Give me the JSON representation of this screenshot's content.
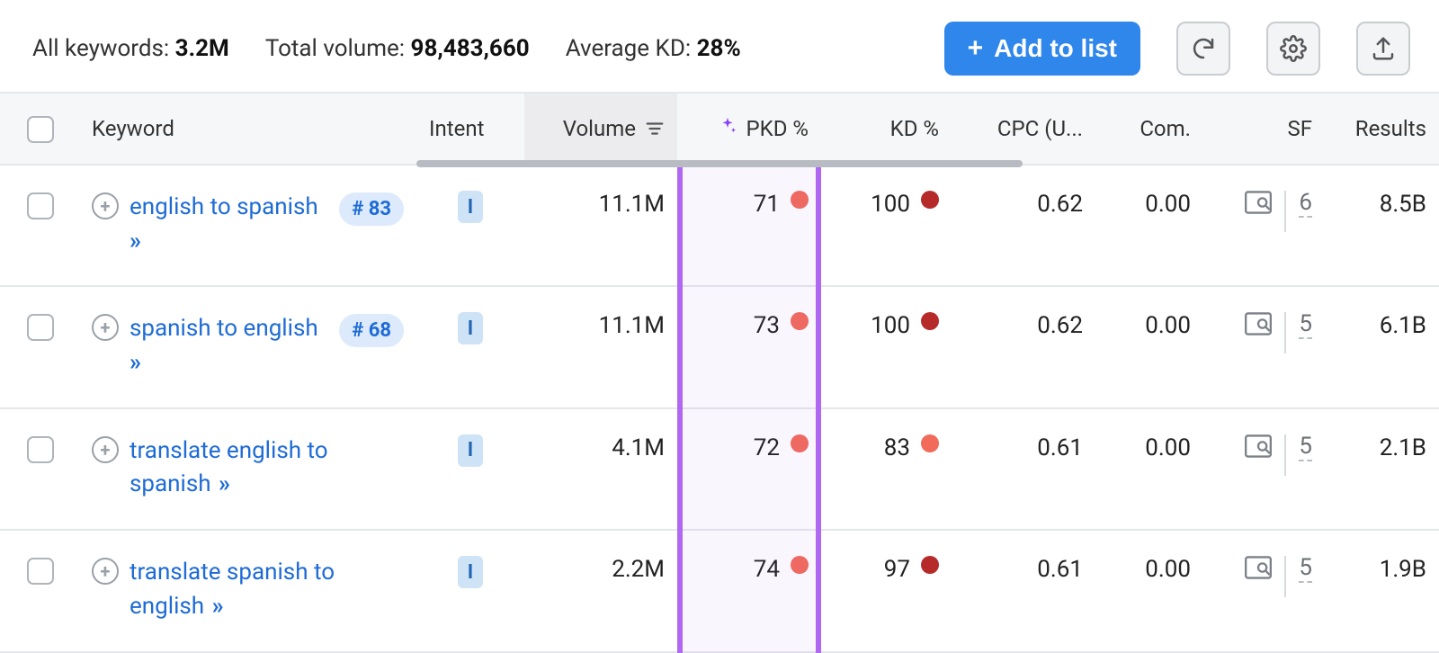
{
  "summary": {
    "all_keywords_label": "All keywords: ",
    "all_keywords_value": "3.2M",
    "total_volume_label": "Total volume: ",
    "total_volume_value": "98,483,660",
    "avg_kd_label": "Average KD: ",
    "avg_kd_value": "28%"
  },
  "actions": {
    "add_to_list": "Add to list"
  },
  "columns": {
    "keyword": "Keyword",
    "intent": "Intent",
    "volume": "Volume",
    "pkd": "PKD %",
    "kd": "KD %",
    "cpc": "CPC (U...",
    "com": "Com.",
    "sf": "SF",
    "results": "Results"
  },
  "intent_label": "I",
  "rows": [
    {
      "keyword": "english to spanish",
      "rank": "# 83",
      "volume": "11.1M",
      "pkd": "71",
      "pkd_color": "orange",
      "kd": "100",
      "kd_color": "darkred",
      "cpc": "0.62",
      "com": "0.00",
      "sf": "6",
      "results": "8.5B"
    },
    {
      "keyword": "spanish to english",
      "rank": "# 68",
      "volume": "11.1M",
      "pkd": "73",
      "pkd_color": "orange",
      "kd": "100",
      "kd_color": "darkred",
      "cpc": "0.62",
      "com": "0.00",
      "sf": "5",
      "results": "6.1B"
    },
    {
      "keyword": "translate english to spanish",
      "rank": "",
      "volume": "4.1M",
      "pkd": "72",
      "pkd_color": "orange",
      "kd": "83",
      "kd_color": "orange",
      "cpc": "0.61",
      "com": "0.00",
      "sf": "5",
      "results": "2.1B"
    },
    {
      "keyword": "translate spanish to english",
      "rank": "",
      "volume": "2.2M",
      "pkd": "74",
      "pkd_color": "orange",
      "kd": "97",
      "kd_color": "darkred",
      "cpc": "0.61",
      "com": "0.00",
      "sf": "5",
      "results": "1.9B"
    }
  ]
}
